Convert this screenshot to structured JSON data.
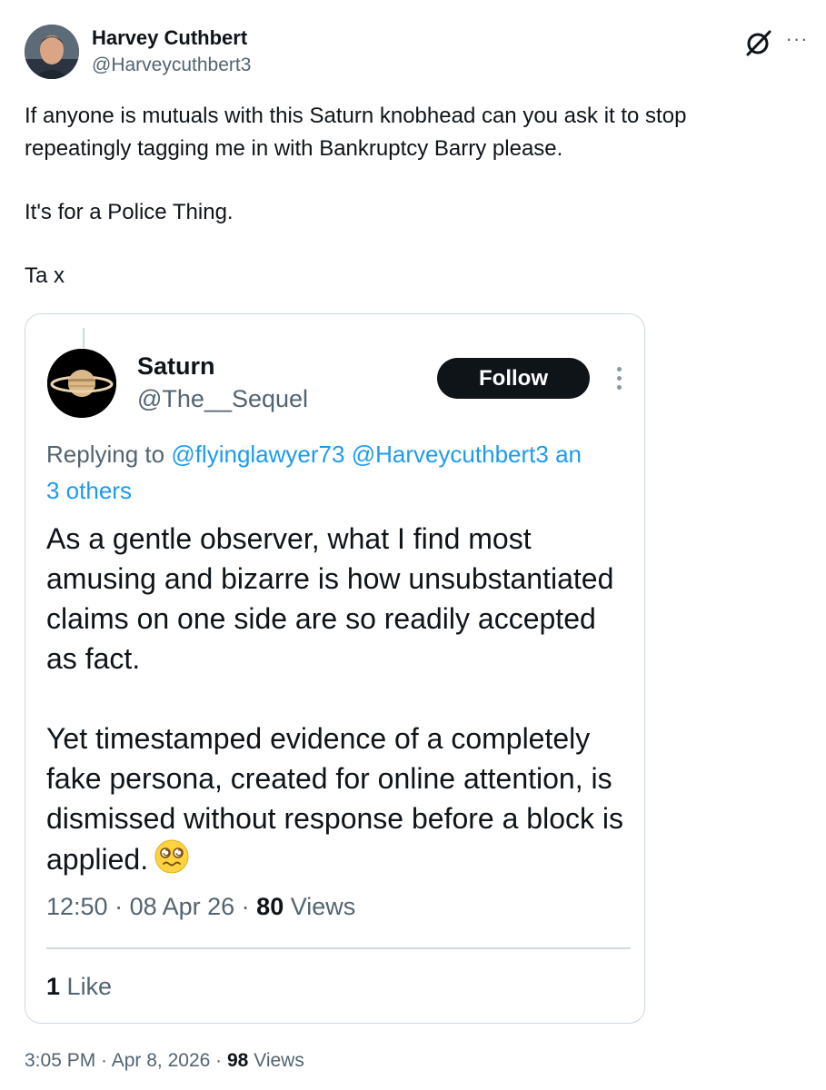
{
  "post": {
    "author": {
      "name": "Harvey Cuthbert",
      "handle": "@Harveycuthbert3",
      "avatar_icon": "profile-photo"
    },
    "paragraphs": [
      "If anyone is mutuals with this Saturn knobhead can you ask it to stop repeatingly tagging me in  with Bankruptcy Barry please.",
      "It's for a Police Thing.",
      "Ta x"
    ],
    "time": "3:05 PM",
    "date": "Apr 8, 2026",
    "views_count": "98",
    "views_label": "Views",
    "separator": " · "
  },
  "quote": {
    "author": {
      "name": "Saturn",
      "handle": "@The__Sequel",
      "avatar_icon": "saturn-planet"
    },
    "follow_label": "Follow",
    "replying_prefix": "Replying to",
    "mentions": [
      "@flyinglawyer73",
      "@Harveycuthbert3",
      "an"
    ],
    "others_label": "3 others",
    "paragraphs": [
      "As a gentle observer, what I find most amusing and bizarre is how unsubstantiated claims on one side are so readily accepted as fact.",
      "Yet timestamped evidence of a completely fake persona, created for online attention, is dismissed without response before a block is applied."
    ],
    "emoji": "woozy-dizzy-face",
    "time": "12:50",
    "date": "08 Apr 26",
    "views_count": "80",
    "views_label": "Views",
    "separator": " · ",
    "likes_count": "1",
    "likes_label": "Like"
  },
  "colors": {
    "text_primary": "#0f1419",
    "text_secondary": "#536471",
    "link": "#1d9bf0",
    "border": "#cfd9de"
  }
}
